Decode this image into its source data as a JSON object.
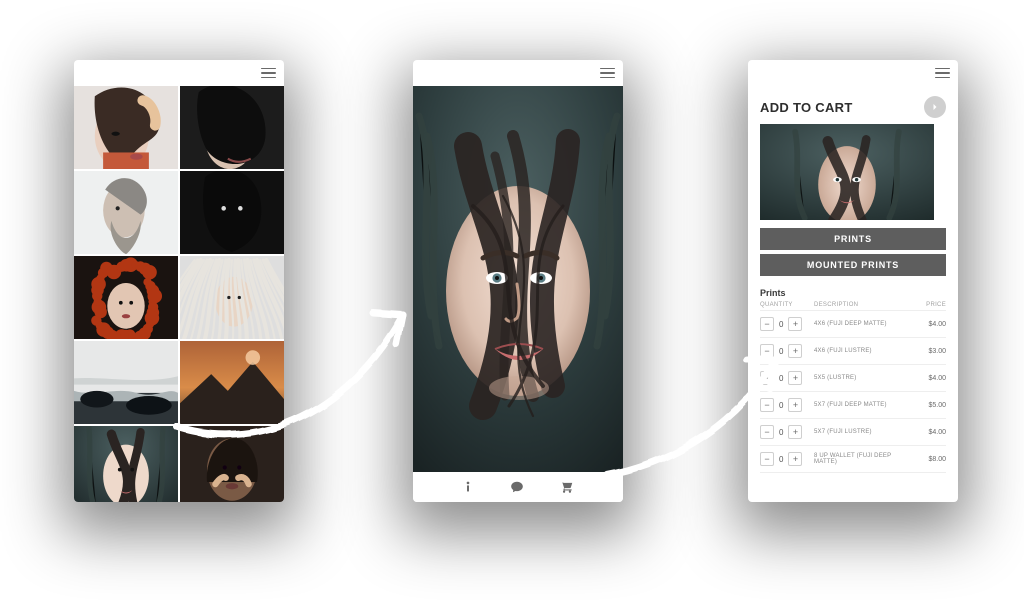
{
  "hamburger_icon_name": "menu-icon",
  "phone1": {
    "tiles": [
      {
        "name": "tile-woman-orange"
      },
      {
        "name": "tile-woman-dark"
      },
      {
        "name": "tile-man-beard"
      },
      {
        "name": "tile-woman-masked"
      },
      {
        "name": "tile-woman-redhair"
      },
      {
        "name": "tile-woman-white"
      },
      {
        "name": "tile-seascape"
      },
      {
        "name": "tile-sunset"
      },
      {
        "name": "tile-woman-fur"
      },
      {
        "name": "tile-woman-hands"
      },
      {
        "name": "tile-moody-land"
      },
      {
        "name": "tile-moody-land-2"
      }
    ]
  },
  "phone2": {
    "photo_name": "hero-woman-fur",
    "bottom_icons": [
      "info-icon",
      "comment-icon",
      "cart-icon"
    ]
  },
  "phone3": {
    "title": "ADD TO CART",
    "go_icon": "right-arrow-icon",
    "thumb_name": "thumb-woman-fur",
    "tabs": [
      "PRINTS",
      "MOUNTED PRINTS"
    ],
    "list_title": "Prints",
    "columns": [
      "QUANTITY",
      "DESCRIPTION",
      "PRICE"
    ],
    "rows": [
      {
        "qty": "0",
        "desc": "4X6 (FUJI DEEP MATTE)",
        "price": "$4.00"
      },
      {
        "qty": "0",
        "desc": "4X6 (FUJI LUSTRE)",
        "price": "$3.00"
      },
      {
        "qty": "0",
        "desc": "5X5 (LUSTRE)",
        "price": "$4.00"
      },
      {
        "qty": "0",
        "desc": "5X7 (FUJI DEEP MATTE)",
        "price": "$5.00"
      },
      {
        "qty": "0",
        "desc": "5X7 (FUJI LUSTRE)",
        "price": "$4.00"
      },
      {
        "qty": "0",
        "desc": "8 UP WALLET (FUJI DEEP MATTE)",
        "price": "$8.00"
      }
    ]
  }
}
